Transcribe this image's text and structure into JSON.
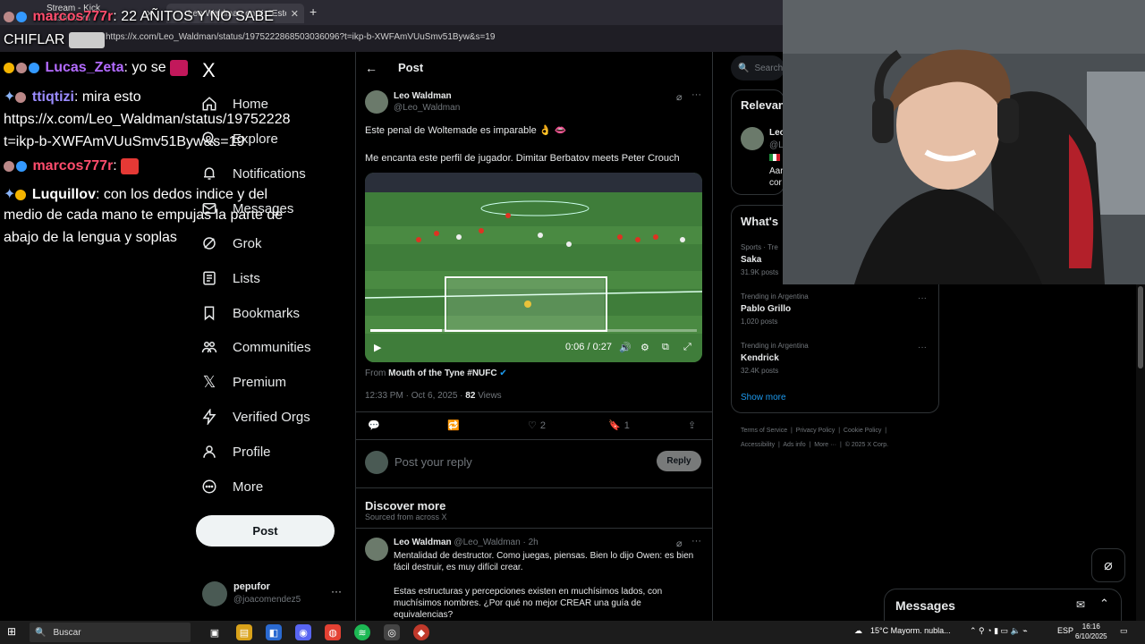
{
  "browser": {
    "tabs": [
      {
        "label": "Stream - Kick Dashboard"
      },
      {
        "label": "Leo Waldman en X: \"Este penal"
      }
    ],
    "new_tab_label": "+",
    "url": "https://x.com/Leo_Waldman/status/1975222868503036096?t=ikp-b-XWFAmVUuSmv51Byw&s=19"
  },
  "chat": {
    "header_user": "marcos777r",
    "header_msg": ": 22 AÑITOS Y NO SABE",
    "header_msg2": "CHIFLAR",
    "messages": [
      {
        "user": "Lucas_Zeta",
        "text": ": yo se",
        "color": "#b36bff"
      },
      {
        "user": "ttiqtizi",
        "text": ": mira esto",
        "color": "#9b8cff"
      },
      {
        "user": "",
        "text": "https://x.com/Leo_Waldman/status/19752228",
        "color": "#ffffff"
      },
      {
        "user": "",
        "text": "t=ikp-b-XWFAmVUuSmv51Byw&s=19",
        "color": "#ffffff"
      },
      {
        "user": "marcos777r",
        "text": ":",
        "color": "#ff4d6d"
      },
      {
        "user": "Luquillov",
        "text": ": con los dedos indice y del",
        "color": "#ffffff"
      },
      {
        "user": "",
        "text": "medio de cada mano te empujas la parte de",
        "color": "#ffffff"
      },
      {
        "user": "",
        "text": "abajo de la lengua y soplas",
        "color": "#ffffff"
      }
    ]
  },
  "nav": {
    "logo": "X",
    "items": [
      {
        "label": "Home",
        "icon": "home-icon"
      },
      {
        "label": "Explore",
        "icon": "search-icon"
      },
      {
        "label": "Notifications",
        "icon": "bell-icon"
      },
      {
        "label": "Messages",
        "icon": "mail-icon"
      },
      {
        "label": "Grok",
        "icon": "grok-icon"
      },
      {
        "label": "Lists",
        "icon": "list-icon"
      },
      {
        "label": "Bookmarks",
        "icon": "bookmark-icon"
      },
      {
        "label": "Communities",
        "icon": "people-icon"
      },
      {
        "label": "Premium",
        "icon": "x-icon"
      },
      {
        "label": "Verified Orgs",
        "icon": "lightning-icon"
      },
      {
        "label": "Profile",
        "icon": "person-icon"
      },
      {
        "label": "More",
        "icon": "more-circle-icon"
      }
    ],
    "post_button": "Post",
    "account": {
      "name": "pepufor",
      "handle": "@joacomendez5",
      "more": "···"
    }
  },
  "post": {
    "header": "Post",
    "author": "Leo Waldman",
    "handle": "@Leo_Waldman",
    "text1": "Este penal de Woltemade es imparable 👌 👄",
    "text2": "Me encanta este perfil de jugador. Dimitar Berbatov meets Peter Crouch",
    "video": {
      "time": "0:06 / 0:27",
      "progress": 0.22
    },
    "from_label": "From",
    "from_source": "Mouth of the Tyne #NUFC",
    "timestamp": "12:33 PM · Oct 6, 2025 ·",
    "views_count": "82",
    "views_label": "Views",
    "actions": {
      "likes": "2",
      "bookmarks": "1"
    },
    "reply_placeholder": "Post your reply",
    "reply_button": "Reply"
  },
  "discover": {
    "title": "Discover more",
    "subtitle": "Sourced from across X",
    "item": {
      "author": "Leo Waldman",
      "handle_time": "@Leo_Waldman · 2h",
      "line1": "Mentalidad de destructor. Como juegas, piensas. Bien lo dijo Owen: es bien",
      "line2": "fácil destruir, es muy difícil crear.",
      "line3": "Estas estructuras y percepciones existen en muchísimos lados, con",
      "line4": "muchísimos nombres. ¿Por qué no mejor CREAR una guía de",
      "line5": "equivalencias?"
    }
  },
  "right": {
    "search_placeholder": "Search",
    "relevant_title": "Relevan",
    "relevant_partial": [
      "Leo",
      "@L",
      "Aar",
      "cor"
    ],
    "whats_title": "What's",
    "trends": [
      {
        "category": "Sports · Tre",
        "name": "Saka",
        "count": "31.9K posts"
      },
      {
        "category": "Trending in Argentina",
        "name": "Pablo Grillo",
        "count": "1,020 posts"
      },
      {
        "category": "Trending in Argentina",
        "name": "Kendrick",
        "count": "32.4K posts"
      }
    ],
    "show_more": "Show more",
    "footer_line1": [
      "Terms of Service",
      "Privacy Policy",
      "Cookie Policy"
    ],
    "footer_line2": [
      "Accessibility",
      "Ads info",
      "More ···",
      "© 2025 X Corp."
    ]
  },
  "messages_drawer": {
    "title": "Messages"
  },
  "taskbar": {
    "search_placeholder": "Buscar",
    "weather": "15°C  Mayorm. nubla...",
    "lang": "ESP",
    "time": "16:16",
    "date": "6/10/2025"
  },
  "colors": {
    "accent": "#1d9bf0",
    "background": "#000000",
    "border": "#2f3336",
    "muted": "#71767b"
  }
}
